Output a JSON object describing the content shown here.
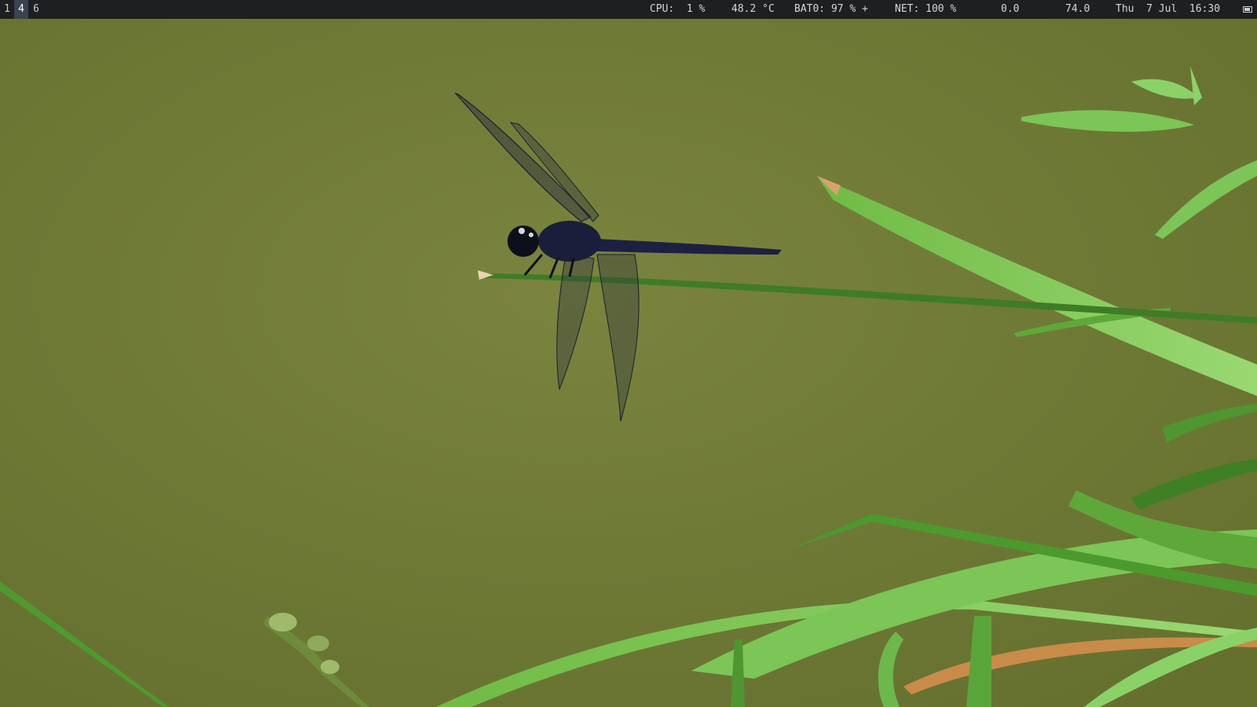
{
  "statusbar": {
    "workspaces": [
      {
        "label": "1",
        "active": false
      },
      {
        "label": "4",
        "active": true
      },
      {
        "label": "6",
        "active": false
      }
    ],
    "cpu": "CPU:  1 %",
    "temp": "48.2 °C",
    "battery": "BAT0: 97 % +",
    "net": "NET: 100 %",
    "load": "0.0",
    "value2": "74.0",
    "datetime": "Thu  7 Jul  16:30",
    "tray_icon": "battery-icon"
  },
  "wallpaper": {
    "subject": "dragonfly-on-grass-blade",
    "colors": {
      "water": "#6f7a35",
      "water_light": "#7a843e",
      "leaf": "#5ea83a",
      "leaf_light": "#8fd06a",
      "dragonfly": "#1a1d33"
    }
  }
}
